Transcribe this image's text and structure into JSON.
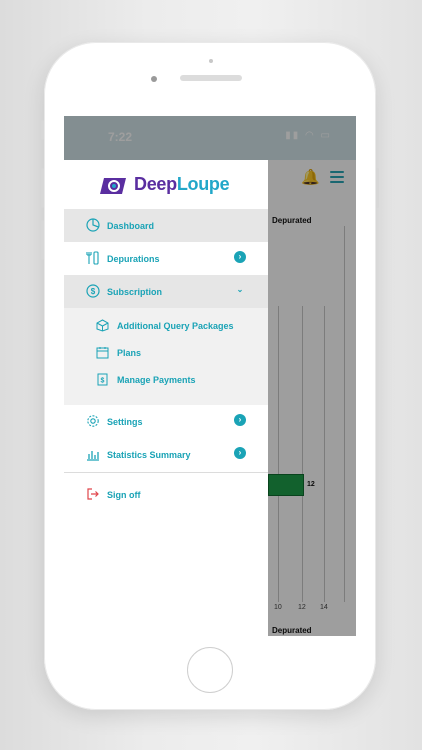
{
  "status_bar": {
    "time": "7:22",
    "icons": "▮▮ ◠ ▭"
  },
  "brand": {
    "part1": "Deep",
    "part2": "Loupe"
  },
  "menu": {
    "dashboard": "Dashboard",
    "depurations": "Depurations",
    "subscription": "Subscription",
    "sub_items": [
      "Additional Query Packages",
      "Plans",
      "Manage Payments"
    ],
    "settings": "Settings",
    "statistics": "Statistics Summary",
    "sign_off": "Sign off"
  },
  "background_chart": {
    "label_top": "Depurated",
    "label_bottom": "Depurated",
    "bar_value": "12",
    "ticks": [
      "10",
      "12",
      "14"
    ]
  },
  "chart_data": {
    "type": "bar",
    "categories": [
      "Depurated"
    ],
    "values": [
      12
    ],
    "xticks": [
      10,
      12,
      14
    ]
  },
  "colors": {
    "accent": "#1aa3b6",
    "brand_purple": "#5a2ea0",
    "brand_cyan": "#22a7c9",
    "bar": "#1e9d4a",
    "sign_off_icon": "#e0454b"
  }
}
